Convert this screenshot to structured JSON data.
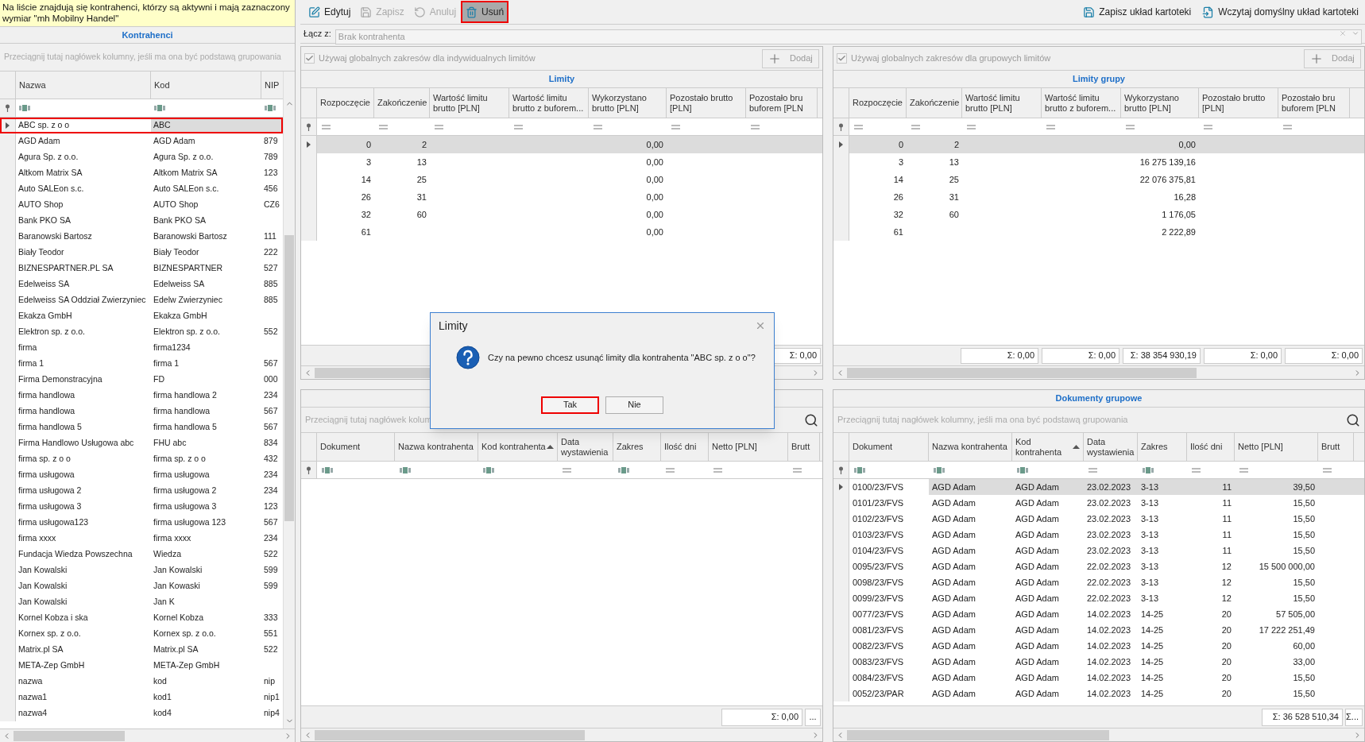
{
  "notice": "Na liście znajdują się kontrahenci, którzy są aktywni i mają zaznaczony wymiar \"mh Mobilny Handel\"",
  "contractors": {
    "title": "Kontrahenci",
    "group_hint": "Przeciągnij tutaj nagłówek kolumny, jeśli ma ona być podstawą grupowania",
    "columns": [
      {
        "label": "Nazwa",
        "kind": "text"
      },
      {
        "label": "Kod",
        "kind": "text"
      },
      {
        "label": "NIP",
        "kind": "text"
      }
    ],
    "rows": [
      {
        "cells": [
          "ABC sp. z o o",
          "ABC",
          null
        ],
        "selected": true
      },
      {
        "cells": [
          "AGD Adam",
          "AGD Adam",
          "879"
        ],
        "selected": false
      },
      {
        "cells": [
          "Agura Sp. z o.o.",
          "Agura Sp. z o.o.",
          "789"
        ],
        "selected": false
      },
      {
        "cells": [
          "Altkom Matrix SA",
          "Altkom Matrix SA",
          "123"
        ],
        "selected": false
      },
      {
        "cells": [
          "Auto SALEon s.c.",
          "Auto SALEon s.c.",
          "456"
        ],
        "selected": false
      },
      {
        "cells": [
          "AUTO Shop",
          "AUTO Shop",
          "CZ6"
        ],
        "selected": false
      },
      {
        "cells": [
          "Bank PKO SA",
          "Bank PKO SA",
          null
        ],
        "selected": false
      },
      {
        "cells": [
          "Baranowski Bartosz",
          "Baranowski Bartosz",
          "111"
        ],
        "selected": false
      },
      {
        "cells": [
          "Biały Teodor",
          "Biały Teodor",
          "222"
        ],
        "selected": false
      },
      {
        "cells": [
          "BIZNESPARTNER.PL SA",
          "BIZNESPARTNER",
          "527"
        ],
        "selected": false
      },
      {
        "cells": [
          "Edelweiss SA",
          "Edelweiss SA",
          "885"
        ],
        "selected": false
      },
      {
        "cells": [
          "Edelweiss SA Oddział Zwierzyniec",
          "Edelw Zwierzyniec",
          "885"
        ],
        "selected": false
      },
      {
        "cells": [
          "Ekakza GmbH",
          "Ekakza GmbH",
          null
        ],
        "selected": false
      },
      {
        "cells": [
          "Elektron sp. z o.o.",
          "Elektron sp. z o.o.",
          "552"
        ],
        "selected": false
      },
      {
        "cells": [
          "firma",
          "firma1234",
          null
        ],
        "selected": false
      },
      {
        "cells": [
          "firma 1",
          "firma 1",
          "567"
        ],
        "selected": false
      },
      {
        "cells": [
          "Firma Demonstracyjna",
          "FD",
          "000"
        ],
        "selected": false
      },
      {
        "cells": [
          "firma handlowa",
          "firma handlowa 2",
          "234"
        ],
        "selected": false
      },
      {
        "cells": [
          "firma handlowa",
          "firma handlowa",
          "567"
        ],
        "selected": false
      },
      {
        "cells": [
          "firma handlowa 5",
          "firma handlowa 5",
          "567"
        ],
        "selected": false
      },
      {
        "cells": [
          "Firma Handlowo Usługowa abc",
          "FHU abc",
          "834"
        ],
        "selected": false
      },
      {
        "cells": [
          "firma sp. z o o",
          "firma sp. z o o",
          "432"
        ],
        "selected": false
      },
      {
        "cells": [
          "firma usługowa",
          "firma usługowa",
          "234"
        ],
        "selected": false
      },
      {
        "cells": [
          "firma usługowa 2",
          "firma usługowa 2",
          "234"
        ],
        "selected": false
      },
      {
        "cells": [
          "firma usługowa 3",
          "firma usługowa 3",
          "123"
        ],
        "selected": false
      },
      {
        "cells": [
          "firma usługowa123",
          "firma usługowa 123",
          "567"
        ],
        "selected": false
      },
      {
        "cells": [
          "firma xxxx",
          "firma xxxx",
          "234"
        ],
        "selected": false
      },
      {
        "cells": [
          "Fundacja Wiedza Powszechna",
          "Wiedza",
          "522"
        ],
        "selected": false
      },
      {
        "cells": [
          "Jan Kowalski",
          "Jan Kowalski",
          "599"
        ],
        "selected": false
      },
      {
        "cells": [
          "Jan Kowalski",
          "Jan Kowaski",
          "599"
        ],
        "selected": false
      },
      {
        "cells": [
          "Jan Kowalski",
          "Jan K",
          null
        ],
        "selected": false
      },
      {
        "cells": [
          "Kornel Kobza i ska",
          "Kornel Kobza",
          "333"
        ],
        "selected": false
      },
      {
        "cells": [
          "Kornex sp. z o.o.",
          "Kornex sp. z o.o.",
          "551"
        ],
        "selected": false
      },
      {
        "cells": [
          "Matrix.pl SA",
          "Matrix.pl SA",
          "522"
        ],
        "selected": false
      },
      {
        "cells": [
          "META-Zep GmbH",
          "META-Zep GmbH",
          null
        ],
        "selected": false
      },
      {
        "cells": [
          "nazwa",
          "kod",
          "nip"
        ],
        "selected": false
      },
      {
        "cells": [
          "nazwa1",
          "kod1",
          "nip1"
        ],
        "selected": false
      },
      {
        "cells": [
          "nazwa4",
          "kod4",
          "nip4"
        ],
        "selected": false
      }
    ]
  },
  "toolbar": {
    "buttons": [
      {
        "label": "Edytuj",
        "disabled": false,
        "selected": false
      },
      {
        "label": "Zapisz",
        "disabled": true,
        "selected": false
      },
      {
        "label": "Anuluj",
        "disabled": true,
        "selected": false
      },
      {
        "label": "Usuń",
        "disabled": false,
        "selected": true
      }
    ],
    "right_buttons": [
      {
        "label": "Zapisz układ kartoteki"
      },
      {
        "label": "Wczytaj domyślny układ kartoteki"
      }
    ]
  },
  "link_field": {
    "label": "Łącz z:",
    "placeholder": "Brak kontrahenta"
  },
  "limits": {
    "checkbox": {
      "label": "Używaj globalnych zakresów dla indywidualnych limitów",
      "checked": true,
      "disabled": true
    },
    "add_button": {
      "label": "Dodaj",
      "disabled": true
    },
    "title": "Limity",
    "columns": [
      {
        "label": "Rozpoczęcie",
        "kind": "number"
      },
      {
        "label": "Zakończenie",
        "kind": "number"
      },
      {
        "label": "Wartość limitu brutto [PLN]",
        "kind": "number"
      },
      {
        "label": "Wartość limitu brutto z buforem...",
        "kind": "number"
      },
      {
        "label": "Wykorzystano brutto [PLN]",
        "kind": "number"
      },
      {
        "label": "Pozostało brutto [PLN]",
        "kind": "number"
      },
      {
        "label": "Pozostało bru buforem [PLN",
        "kind": "number"
      }
    ],
    "rows": [
      {
        "cells": [
          "0",
          "2",
          null,
          null,
          "0,00",
          null,
          null
        ],
        "selected": true
      },
      {
        "cells": [
          "3",
          "13",
          null,
          null,
          "0,00",
          null,
          null
        ],
        "selected": false
      },
      {
        "cells": [
          "14",
          "25",
          null,
          null,
          "0,00",
          null,
          null
        ],
        "selected": false
      },
      {
        "cells": [
          "26",
          "31",
          null,
          null,
          "0,00",
          null,
          null
        ],
        "selected": false
      },
      {
        "cells": [
          "32",
          "60",
          null,
          null,
          "0,00",
          null,
          null
        ],
        "selected": false
      },
      {
        "cells": [
          "61",
          null,
          null,
          null,
          "0,00",
          null,
          null
        ],
        "selected": false
      }
    ],
    "totals": [
      "Σ: 0,00"
    ]
  },
  "group_limits": {
    "checkbox": {
      "label": "Używaj globalnych zakresów dla grupowych limitów",
      "checked": true,
      "disabled": true
    },
    "add_button": {
      "label": "Dodaj",
      "disabled": true
    },
    "title": "Limity grupy",
    "columns": [
      {
        "label": "Rozpoczęcie",
        "kind": "number"
      },
      {
        "label": "Zakończenie",
        "kind": "number"
      },
      {
        "label": "Wartość limitu brutto [PLN]",
        "kind": "number"
      },
      {
        "label": "Wartość limitu brutto z buforem...",
        "kind": "number"
      },
      {
        "label": "Wykorzystano brutto [PLN]",
        "kind": "number"
      },
      {
        "label": "Pozostało brutto [PLN]",
        "kind": "number"
      },
      {
        "label": "Pozostało bru buforem [PLN",
        "kind": "number"
      }
    ],
    "rows": [
      {
        "cells": [
          "0",
          "2",
          null,
          null,
          "0,00",
          null,
          null
        ],
        "selected": true
      },
      {
        "cells": [
          "3",
          "13",
          null,
          null,
          "16 275 139,16",
          null,
          null
        ],
        "selected": false
      },
      {
        "cells": [
          "14",
          "25",
          null,
          null,
          "22 076 375,81",
          null,
          null
        ],
        "selected": false
      },
      {
        "cells": [
          "26",
          "31",
          null,
          null,
          "16,28",
          null,
          null
        ],
        "selected": false
      },
      {
        "cells": [
          "32",
          "60",
          null,
          null,
          "1 176,05",
          null,
          null
        ],
        "selected": false
      },
      {
        "cells": [
          "61",
          null,
          null,
          null,
          "2 222,89",
          null,
          null
        ],
        "selected": false
      }
    ],
    "totals": [
      "Σ: 0,00",
      "Σ: 0,00",
      "Σ: 38 354 930,19",
      "Σ: 0,00",
      "Σ: 0,00"
    ]
  },
  "documents": {
    "group_hint": "Przeciągnij tutaj nagłówek kolum",
    "columns": [
      {
        "label": "Dokument",
        "kind": "text",
        "sorted": false
      },
      {
        "label": "Nazwa kontrahenta",
        "kind": "text",
        "sorted": false
      },
      {
        "label": "Kod kontrahenta",
        "kind": "text",
        "sorted": true
      },
      {
        "label": "Data wystawienia",
        "kind": "date",
        "sorted": false
      },
      {
        "label": "Zakres",
        "kind": "text",
        "sorted": false
      },
      {
        "label": "Ilość dni",
        "kind": "number",
        "sorted": false
      },
      {
        "label": "Netto [PLN]",
        "kind": "number",
        "sorted": false
      },
      {
        "label": "Brutt",
        "kind": "number",
        "sorted": false
      }
    ],
    "totals": [
      "Σ: 0,00"
    ],
    "more_button": "..."
  },
  "group_documents": {
    "title": "Dokumenty grupowe",
    "group_hint": "Przeciągnij tutaj nagłówek kolumny, jeśli ma ona być podstawą grupowania",
    "columns": [
      {
        "label": "Dokument",
        "kind": "text",
        "sorted": false
      },
      {
        "label": "Nazwa kontrahenta",
        "kind": "text",
        "sorted": false
      },
      {
        "label": "Kod kontrahenta",
        "kind": "text",
        "sorted": true
      },
      {
        "label": "Data wystawienia",
        "kind": "date",
        "sorted": false
      },
      {
        "label": "Zakres",
        "kind": "text",
        "sorted": false
      },
      {
        "label": "Ilość dni",
        "kind": "number",
        "sorted": false
      },
      {
        "label": "Netto [PLN]",
        "kind": "number",
        "sorted": false
      },
      {
        "label": "Brutt",
        "kind": "number",
        "sorted": false
      }
    ],
    "rows": [
      {
        "cells": [
          "0100/23/FVS",
          "AGD Adam",
          "AGD Adam",
          "23.02.2023",
          "3-13",
          "11",
          "39,50",
          null
        ],
        "selected": true
      },
      {
        "cells": [
          "0101/23/FVS",
          "AGD Adam",
          "AGD Adam",
          "23.02.2023",
          "3-13",
          "11",
          "15,50",
          null
        ],
        "selected": false
      },
      {
        "cells": [
          "0102/23/FVS",
          "AGD Adam",
          "AGD Adam",
          "23.02.2023",
          "3-13",
          "11",
          "15,50",
          null
        ],
        "selected": false
      },
      {
        "cells": [
          "0103/23/FVS",
          "AGD Adam",
          "AGD Adam",
          "23.02.2023",
          "3-13",
          "11",
          "15,50",
          null
        ],
        "selected": false
      },
      {
        "cells": [
          "0104/23/FVS",
          "AGD Adam",
          "AGD Adam",
          "23.02.2023",
          "3-13",
          "11",
          "15,50",
          null
        ],
        "selected": false
      },
      {
        "cells": [
          "0095/23/FVS",
          "AGD Adam",
          "AGD Adam",
          "22.02.2023",
          "3-13",
          "12",
          "15 500 000,00",
          null
        ],
        "selected": false
      },
      {
        "cells": [
          "0098/23/FVS",
          "AGD Adam",
          "AGD Adam",
          "22.02.2023",
          "3-13",
          "12",
          "15,50",
          null
        ],
        "selected": false
      },
      {
        "cells": [
          "0099/23/FVS",
          "AGD Adam",
          "AGD Adam",
          "22.02.2023",
          "3-13",
          "12",
          "15,50",
          null
        ],
        "selected": false
      },
      {
        "cells": [
          "0077/23/FVS",
          "AGD Adam",
          "AGD Adam",
          "14.02.2023",
          "14-25",
          "20",
          "57 505,00",
          null
        ],
        "selected": false
      },
      {
        "cells": [
          "0081/23/FVS",
          "AGD Adam",
          "AGD Adam",
          "14.02.2023",
          "14-25",
          "20",
          "17 222 251,49",
          null
        ],
        "selected": false
      },
      {
        "cells": [
          "0082/23/FVS",
          "AGD Adam",
          "AGD Adam",
          "14.02.2023",
          "14-25",
          "20",
          "60,00",
          null
        ],
        "selected": false
      },
      {
        "cells": [
          "0083/23/FVS",
          "AGD Adam",
          "AGD Adam",
          "14.02.2023",
          "14-25",
          "20",
          "33,00",
          null
        ],
        "selected": false
      },
      {
        "cells": [
          "0084/23/FVS",
          "AGD Adam",
          "AGD Adam",
          "14.02.2023",
          "14-25",
          "20",
          "15,50",
          null
        ],
        "selected": false
      },
      {
        "cells": [
          "0052/23/PAR",
          "AGD Adam",
          "AGD Adam",
          "14.02.2023",
          "14-25",
          "20",
          "15,50",
          null
        ],
        "selected": false
      }
    ],
    "totals": [
      "Σ: 36 528 510,34",
      "Σ..."
    ]
  },
  "dialog": {
    "title": "Limity",
    "message": "Czy na pewno chcesz usunąć limity dla kontrahenta \"ABC sp. z o o\"?",
    "buttons": [
      {
        "label": "Tak",
        "selected": true
      },
      {
        "label": "Nie",
        "selected": false
      }
    ]
  }
}
